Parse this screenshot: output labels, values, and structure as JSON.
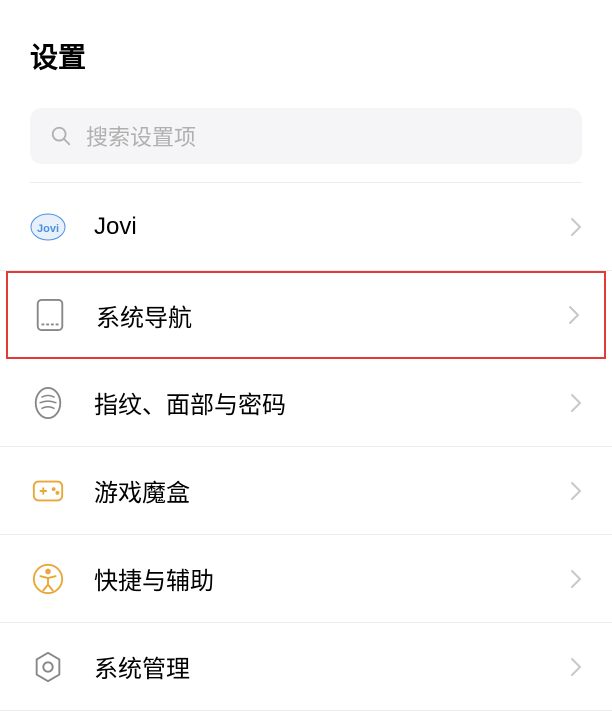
{
  "header": {
    "title": "设置"
  },
  "search": {
    "placeholder": "搜索设置项"
  },
  "items": [
    {
      "label": "Jovi",
      "icon": "jovi"
    },
    {
      "label": "系统导航",
      "icon": "navigation",
      "highlighted": true
    },
    {
      "label": "指纹、面部与密码",
      "icon": "fingerprint"
    },
    {
      "label": "游戏魔盒",
      "icon": "gamebox"
    },
    {
      "label": "快捷与辅助",
      "icon": "accessibility"
    },
    {
      "label": "系统管理",
      "icon": "system"
    }
  ]
}
